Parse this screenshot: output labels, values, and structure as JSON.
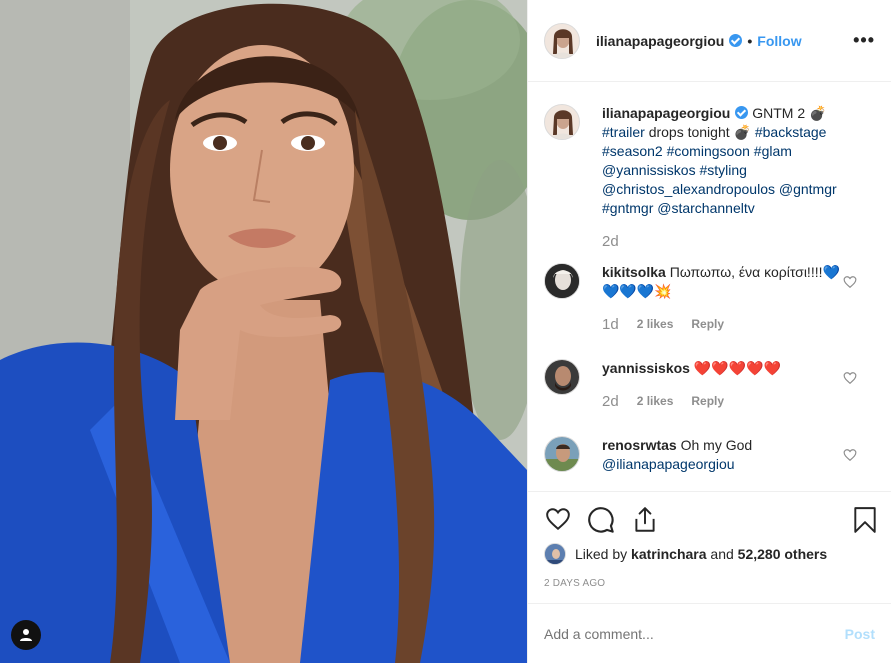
{
  "post": {
    "author": "ilianapapageorgiou",
    "follow_label": "Follow",
    "dot": "•",
    "more_label": "•••",
    "caption": {
      "author": "ilianapapageorgiou",
      "text_1": "GNTM 2 💣",
      "tag_trailer": "#trailer",
      "text_2": "drops tonight 💣",
      "tag_backstage": "#backstage",
      "tag_season2": "#season2",
      "tag_comingsoon": "#comingsoon",
      "tag_glam": "#glam",
      "tag_yannis": "@yannissiskos",
      "tag_styling": "#styling",
      "tag_christos": "@christos_alexandropoulos",
      "tag_gntmgr_at": "@gntmgr",
      "tag_gntmgr_hash": "#gntmgr",
      "tag_star": "@starchanneltv",
      "age": "2d"
    },
    "comments": [
      {
        "user": "kikitsolka",
        "text": "Πωπωπω, ένα κορίτσι!!!!💙💙💙💙💥",
        "age": "1d",
        "likes": "2 likes",
        "reply": "Reply"
      },
      {
        "user": "yannissiskos",
        "text": "❤️❤️❤️❤️❤️",
        "age": "2d",
        "likes": "2 likes",
        "reply": "Reply"
      },
      {
        "user": "renosrwtas",
        "text": "Oh my God",
        "mention": "@ilianapapageorgiou"
      }
    ],
    "liked_by": {
      "prefix": "Liked by",
      "user": "katrinchara",
      "and": "and",
      "count": "52,280 others"
    },
    "timestamp": "2 DAYS AGO",
    "add_comment_placeholder": "Add a comment...",
    "post_label": "Post"
  },
  "colors": {
    "blue": "#3897f0",
    "tag_color": "#00376b",
    "post_disabled": "#b2dffc"
  }
}
